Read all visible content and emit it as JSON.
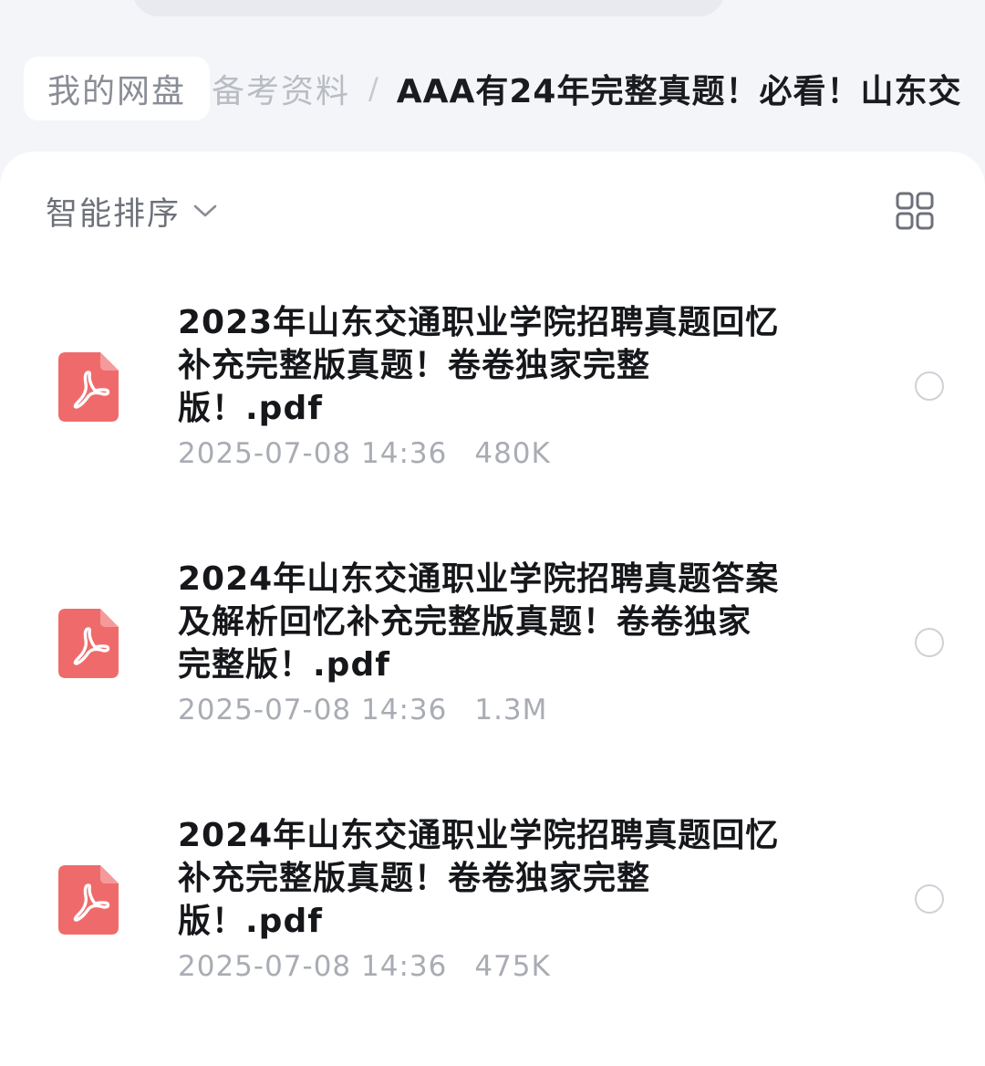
{
  "breadcrumb": {
    "home": "我的网盘",
    "parent": "备考资料",
    "separator": "/",
    "current": "AAA有24年完整真题！必看！山东交"
  },
  "toolbar": {
    "sort_label": "智能排序",
    "sort_icon": "chevron-down-icon",
    "view_toggle_icon": "grid-view-icon"
  },
  "files": [
    {
      "name_line1": "2023年山东交通职业学院招聘真题回忆",
      "name_line2": "补充完整版真题！卷卷独家完整",
      "name_line3": "版！.pdf",
      "date": "2025-07-08 14:36",
      "size": "480K",
      "icon": "pdf-file-icon"
    },
    {
      "name_line1": "2024年山东交通职业学院招聘真题答案",
      "name_line2": "及解析回忆补充完整版真题！卷卷独家",
      "name_line3": "完整版！.pdf",
      "date": "2025-07-08 14:36",
      "size": "1.3M",
      "icon": "pdf-file-icon"
    },
    {
      "name_line1": "2024年山东交通职业学院招聘真题回忆",
      "name_line2": "补充完整版真题！卷卷独家完整",
      "name_line3": "版！.pdf",
      "date": "2025-07-08 14:36",
      "size": "475K",
      "icon": "pdf-file-icon"
    }
  ],
  "colors": {
    "pdf_icon": "#ef6b6b",
    "page_background": "#f4f5f8",
    "text_primary": "#16171a",
    "text_secondary": "#a9acb3"
  }
}
